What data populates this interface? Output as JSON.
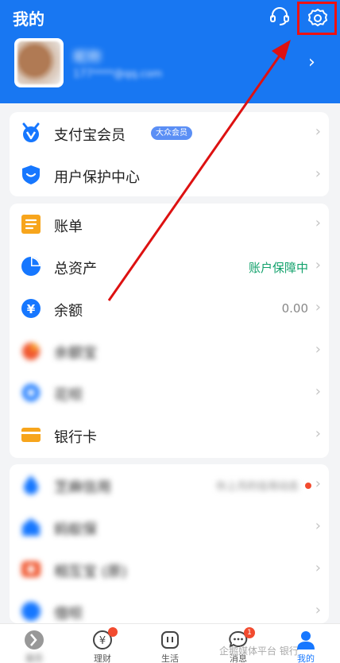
{
  "header": {
    "title": "我的"
  },
  "profile": {
    "name": "昵称",
    "account": "177****@qq.com"
  },
  "card1": [
    {
      "label": "支付宝会员",
      "badge": "大众会员"
    },
    {
      "label": "用户保护中心"
    }
  ],
  "card2": [
    {
      "label": "账单"
    },
    {
      "label": "总资产",
      "right": "账户保障中"
    },
    {
      "label": "余额",
      "right": "0.00"
    },
    {
      "label": "余额宝"
    },
    {
      "label": "花呗"
    },
    {
      "label": "银行卡"
    }
  ],
  "card3": [
    {
      "label": "芝麻信用",
      "right": "你上月的信用动态"
    },
    {
      "label": "蚂蚁保"
    },
    {
      "label": "相互宝 (原)"
    },
    {
      "label": "借呗"
    }
  ],
  "tabs": [
    {
      "label": "首页"
    },
    {
      "label": "理财"
    },
    {
      "label": "生活"
    },
    {
      "label": "消息",
      "badge": "1"
    },
    {
      "label": "我的"
    }
  ],
  "watermark": "企鹅媒体平台 银行",
  "colors": {
    "brand": "#1877f2",
    "highlight_box": "#e11",
    "arrow": "#d11",
    "green": "#12a16b"
  },
  "icons": [
    "support-icon",
    "settings-icon",
    "member-icon",
    "shield-icon",
    "bill-icon",
    "assets-pie-icon",
    "balance-yuan-icon",
    "yuebao-icon",
    "huabei-icon",
    "bankcard-icon",
    "sesame-credit-icon",
    "insurance-icon",
    "mutual-aid-icon",
    "jiebei-icon"
  ]
}
